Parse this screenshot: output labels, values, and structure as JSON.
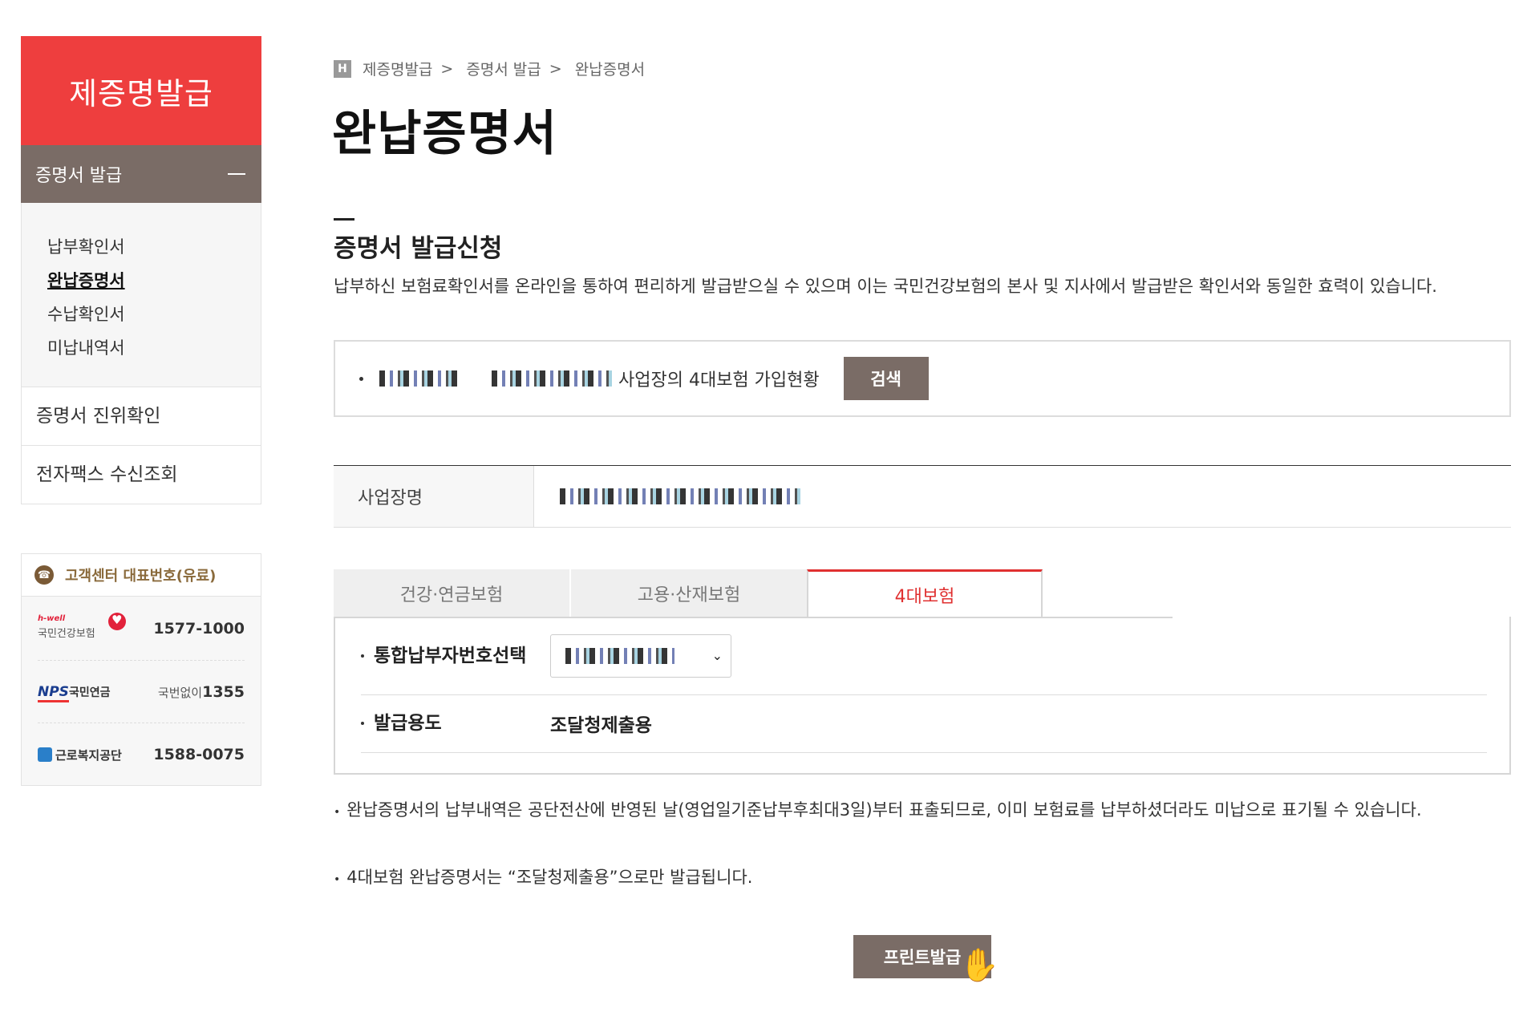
{
  "sidebar": {
    "title": "제증명발급",
    "section": "증명서 발급",
    "sub_items": [
      {
        "label": "납부확인서",
        "active": false
      },
      {
        "label": "완납증명서",
        "active": true
      },
      {
        "label": "수납확인서",
        "active": false
      },
      {
        "label": "미납내역서",
        "active": false
      }
    ],
    "links": [
      "증명서 진위확인",
      "전자팩스 수신조회"
    ]
  },
  "customer_center": {
    "title": "고객센터 대표번호(유료)",
    "rows": [
      {
        "logo_sub": "h-well",
        "logo": "국민건강보험",
        "number": "1577-1000",
        "prefix": ""
      },
      {
        "logo_mark": "NPS",
        "logo": "국민연금",
        "prefix": "국번없이",
        "number": "1355"
      },
      {
        "logo": "근로복지공단",
        "number": "1588-0075",
        "prefix": ""
      }
    ]
  },
  "breadcrumb": {
    "home": "H",
    "items": [
      "제증명발급",
      "증명서 발급",
      "완납증명서"
    ],
    "separator": ">"
  },
  "page_title": "완납증명서",
  "section_title": "증명서 발급신청",
  "description": "납부하신 보험료확인서를 온라인을 통하여 편리하게 발급받으실 수 있으며 이는 국민건강보험의 본사 및 지사에서 발급받은 확인서와 동일한 효력이 있습니다.",
  "search": {
    "label": "사업장의 4대보험 가입현황",
    "button": "검색"
  },
  "business": {
    "label": "사업장명"
  },
  "tabs": [
    {
      "label": "건강·연금보험",
      "active": false
    },
    {
      "label": "고용·산재보험",
      "active": false
    },
    {
      "label": "4대보험",
      "active": true
    }
  ],
  "form": {
    "payer_label": "통합납부자번호선택",
    "purpose_label": "발급용도",
    "purpose_value": "조달청제출용"
  },
  "notes": [
    "완납증명서의 납부내역은 공단전산에 반영된 날(영업일기준납부후최대3일)부터 표출되므로, 이미 보험료를 납부하셨더라도 미납으로 표기될 수 있습니다.",
    "4대보험 완납증명서는 “조달청제출용”으로만 발급됩니다."
  ],
  "print_button": "프린트발급",
  "colors": {
    "accent": "#ee3e3e",
    "brown": "#7a6c66",
    "tab_active": "#e03030"
  },
  "icons": {
    "home": "home-icon",
    "phone": "phone-icon",
    "cursor": "hand-cursor-icon"
  }
}
